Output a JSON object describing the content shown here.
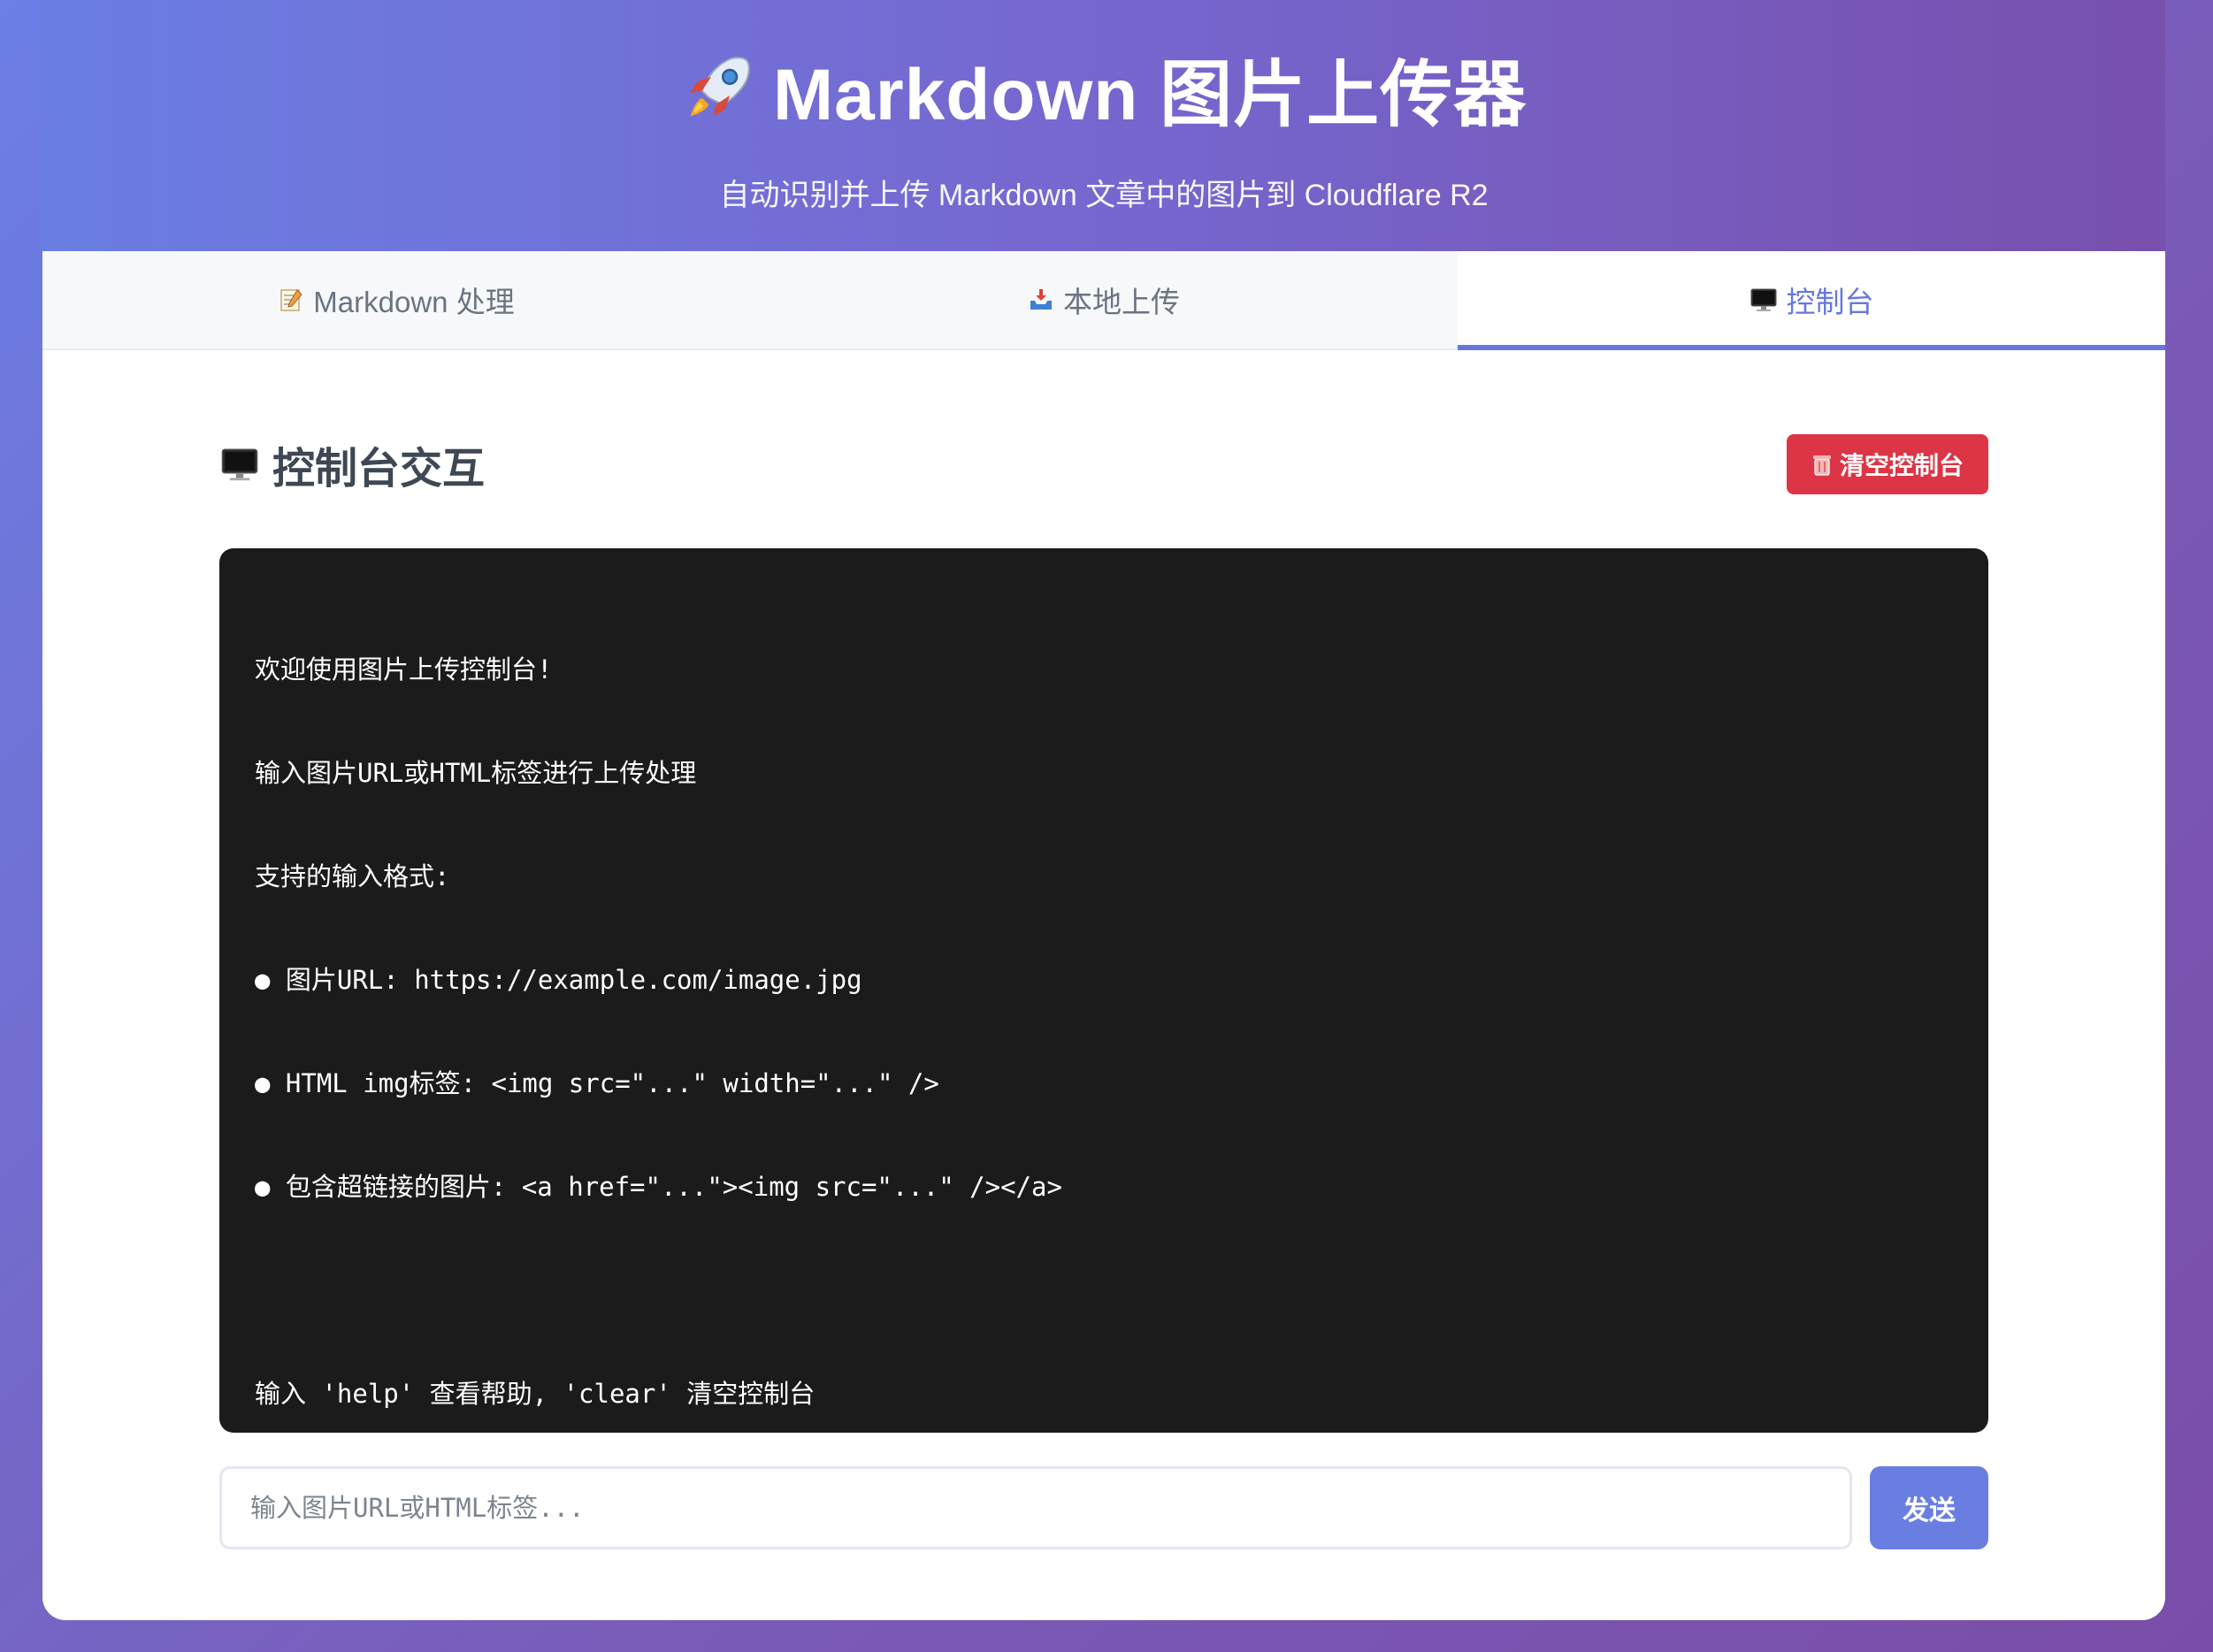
{
  "header": {
    "title": "Markdown 图片上传器",
    "subtitle": "自动识别并上传 Markdown 文章中的图片到 Cloudflare R2",
    "icon": "rocket-icon"
  },
  "tabs": [
    {
      "label": "Markdown 处理",
      "icon": "memo-icon",
      "active": false
    },
    {
      "label": "本地上传",
      "icon": "inbox-tray-icon",
      "active": false
    },
    {
      "label": "控制台",
      "icon": "desktop-computer-icon",
      "active": true
    }
  ],
  "console_section": {
    "title": "控制台交互",
    "title_icon": "desktop-computer-icon",
    "clear_button": "清空控制台",
    "clear_icon": "trash-icon"
  },
  "console": {
    "lines": [
      "欢迎使用图片上传控制台!",
      "输入图片URL或HTML标签进行上传处理",
      "支持的输入格式:",
      "● 图片URL: https://example.com/image.jpg",
      "● HTML img标签: <img src=\"...\" width=\"...\" />",
      "● 包含超链接的图片: <a href=\"...\"><img src=\"...\" /></a>",
      "",
      "输入 'help' 查看帮助, 'clear' 清空控制台"
    ]
  },
  "input": {
    "placeholder": "输入图片URL或HTML标签...",
    "value": "",
    "send_label": "发送"
  },
  "colors": {
    "accent": "#6677e0",
    "danger": "#dc3545",
    "console_bg": "#1b1b1b"
  }
}
